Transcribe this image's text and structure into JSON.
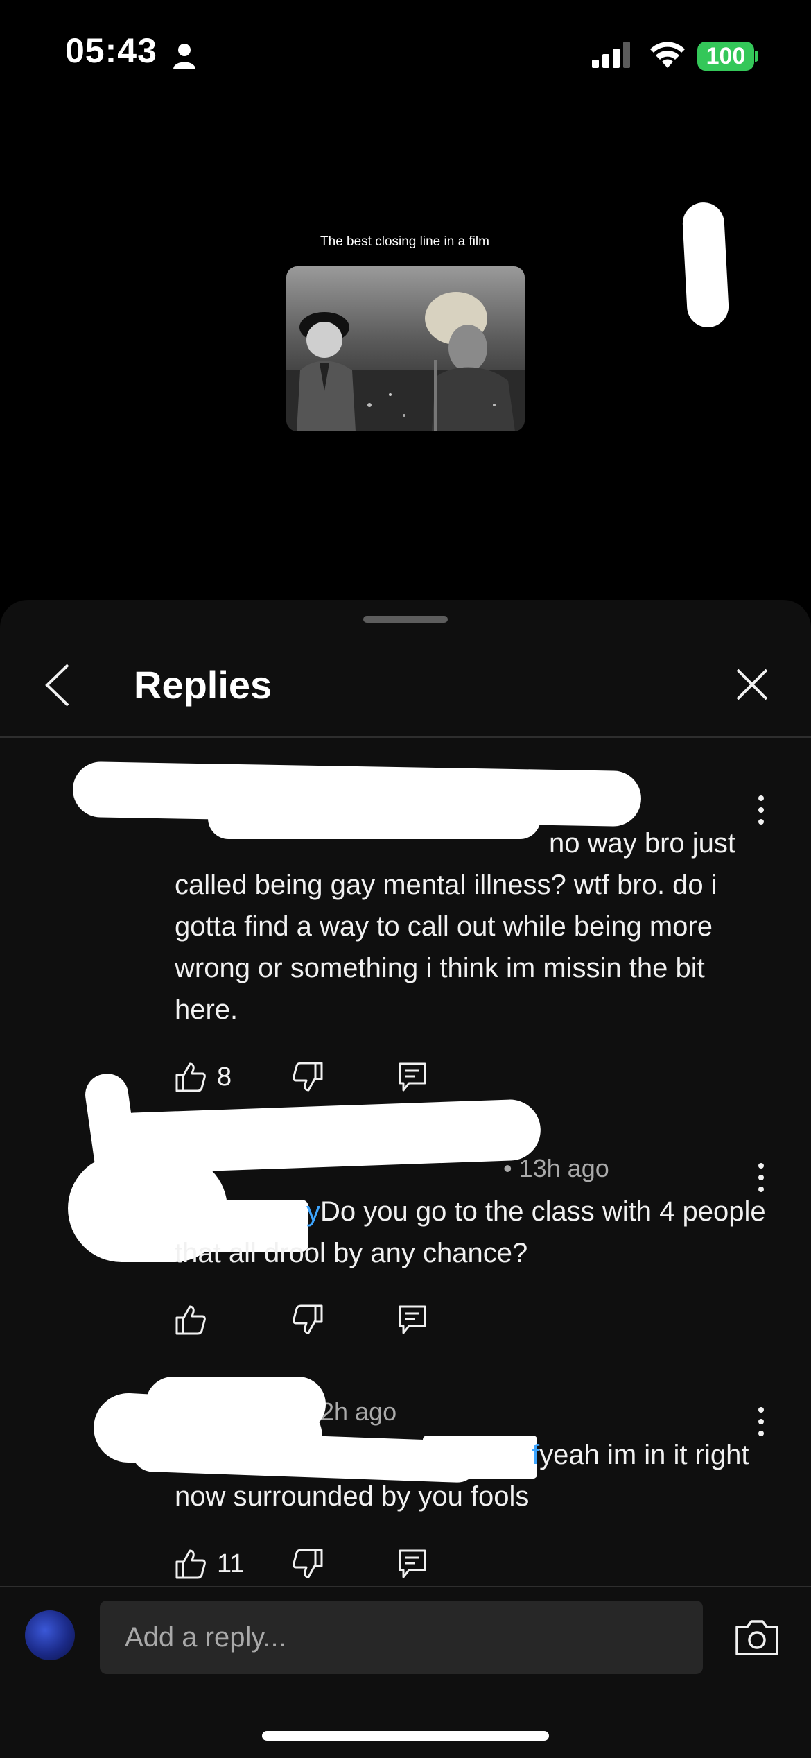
{
  "status_bar": {
    "time": "05:43",
    "battery": "100",
    "icons": [
      "person-icon",
      "signal-icon",
      "wifi-icon",
      "battery-icon"
    ]
  },
  "video": {
    "caption": "The best closing line in a film"
  },
  "sheet": {
    "title": "Replies",
    "back_icon": "chevron-left-icon",
    "close_icon": "close-icon"
  },
  "comments": [
    {
      "mention": "@",
      "text": "no way bro just called being gay mental illness? wtf bro. do i gotta find a way to call out while being more wrong or something i think im missin the bit here.",
      "meta": "",
      "likes": "8"
    },
    {
      "mention": "y",
      "text": "Do you go to the class with 4 people that all drool by any chance?",
      "meta": "• 13h ago",
      "likes": ""
    },
    {
      "mention": "f",
      "text": "yeah im in it right now surrounded by you fools",
      "meta": "2h ago",
      "likes": "11"
    }
  ],
  "reply_box": {
    "placeholder": "Add a reply...",
    "camera_icon": "camera-icon"
  },
  "colors": {
    "background": "#000000",
    "sheet": "#0f0f0f",
    "mention": "#3ea6ff",
    "battery": "#34c759",
    "input": "#272727"
  }
}
